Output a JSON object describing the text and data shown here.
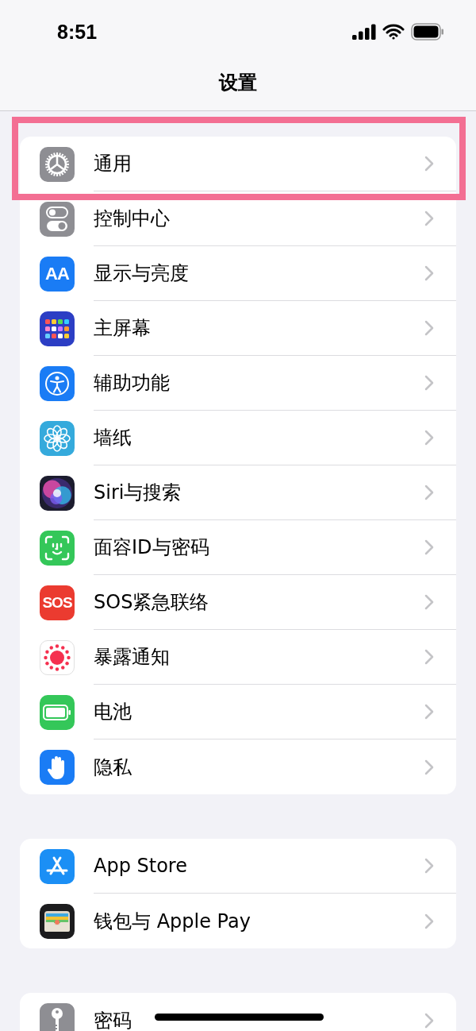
{
  "status_bar": {
    "time": "8:51"
  },
  "nav": {
    "title": "设置"
  },
  "groups": [
    {
      "items": [
        {
          "label": "通用",
          "kind": "gear",
          "color": "#8e8e93",
          "highlighted": true
        },
        {
          "label": "控制中心",
          "kind": "toggles",
          "color": "#8e8e93",
          "highlighted": false
        },
        {
          "label": "显示与亮度",
          "kind": "text",
          "icon_text": "AA",
          "color": "#1a7cf5",
          "highlighted": false
        },
        {
          "label": "主屏幕",
          "kind": "grid",
          "color": "#2c3ec4",
          "highlighted": false
        },
        {
          "label": "辅助功能",
          "kind": "accessibility",
          "color": "#1a7cf5",
          "highlighted": false
        },
        {
          "label": "墙纸",
          "kind": "flower",
          "color": "#35aadc",
          "highlighted": false
        },
        {
          "label": "Siri与搜索",
          "kind": "orb",
          "color": "#1c1c2e",
          "highlighted": false
        },
        {
          "label": "面容ID与密码",
          "kind": "face",
          "color": "#34c759",
          "highlighted": false
        },
        {
          "label": "SOS紧急联络",
          "kind": "text",
          "icon_text": "SOS",
          "color": "#eb3b30",
          "highlighted": false
        },
        {
          "label": "暴露通知",
          "kind": "dots",
          "color": "#ffffff",
          "highlighted": false
        },
        {
          "label": "电池",
          "kind": "battery",
          "color": "#34c759",
          "highlighted": false
        },
        {
          "label": "隐私",
          "kind": "hand",
          "color": "#1a7cf5",
          "highlighted": false
        }
      ]
    },
    {
      "items": [
        {
          "label": "App Store",
          "kind": "appstore",
          "color": "#1b8ff5",
          "highlighted": false
        },
        {
          "label": "钱包与 Apple Pay",
          "kind": "wallet",
          "color": "#1c1c1e",
          "highlighted": false
        }
      ]
    },
    {
      "items": [
        {
          "label": "密码",
          "kind": "key",
          "color": "#8e8e93",
          "highlighted": false
        }
      ]
    }
  ]
}
